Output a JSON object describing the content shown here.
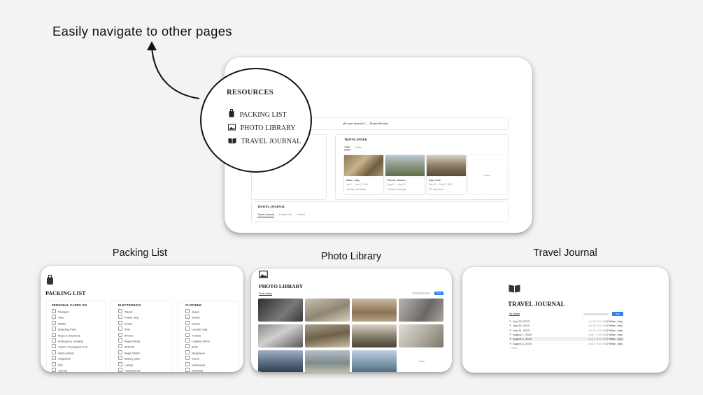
{
  "headline": "Easily navigate to other pages",
  "main_preview": {
    "quote": "ake some memories\" — Donna Sheridan",
    "resources": {
      "title": "RESOURCES",
      "items": [
        {
          "label": "PACKING LIST",
          "icon": "luggage-icon"
        },
        {
          "label": "PHOTO LIBRARY",
          "icon": "image-icon"
        },
        {
          "label": "TRAVEL JOURNAL",
          "icon": "book-icon"
        }
      ]
    },
    "trip_planner": {
      "title": "TRIP PLANNER",
      "tabs": [
        "TRIP",
        "Table"
      ],
      "trips": [
        {
          "place": "Milan, Italy",
          "dates": "Jan 2 → Jan 13, 2024",
          "remaining": "146 days remaining"
        },
        {
          "place": "Rio de Janiero",
          "dates": "Aug 15 → Aug 19",
          "remaining": "25 days remaining"
        },
        {
          "place": "New York",
          "dates": "Feb 18 → Feb 22, 2022",
          "remaining": "517 days since"
        }
      ],
      "new_label": "+ New"
    },
    "travel_journal": {
      "title": "TRAVEL JOURNAL",
      "tabs": [
        "Travel Journal",
        "Bucket List",
        "Visited"
      ]
    }
  },
  "captions": {
    "packing": "Packing List",
    "photo": "Photo Library",
    "journal": "Travel Journal"
  },
  "packing_list": {
    "title": "PACKING LIST",
    "columns": [
      {
        "header": "PERSONAL CARDS ON",
        "items": [
          "Passport",
          "Visa",
          "Wallet",
          "Boarding Pass",
          "Maps & directions",
          "Emergency contacts",
          "Copies of passport & ID",
          "Hotel rentals",
          "Chapstick",
          "Pen",
          "Journal",
          "Pullover",
          "Snacks"
        ]
      },
      {
        "header": "ELECTRONICS",
        "items": [
          "Tripod",
          "Power strip",
          "Kindle",
          "iPad",
          "iPhone",
          "Apple Pencil",
          "AirPods",
          "Apple Watch",
          "Battery pack",
          "Laptop",
          "Headphones",
          "Chargers"
        ]
      },
      {
        "header": "CLOTHING",
        "items": [
          "Jeans",
          "Shorts",
          "Jacket",
          "Laundry bag",
          "T-shirts",
          "Collared shirts",
          "Belts",
          "Sleepwear",
          "Socks",
          "Underwear",
          "Swimsuit",
          "Bras"
        ]
      }
    ]
  },
  "photo_library": {
    "title": "PHOTO LIBRARY",
    "view_tab": "Photo Library",
    "new_button": "New",
    "new_label": "+ New"
  },
  "travel_journal_page": {
    "title": "TRAVEL JOURNAL",
    "view_label": "All entries",
    "new_button": "New",
    "entries": [
      {
        "title": "July 29, 2023",
        "date": "Jul 29 9:00 AM",
        "location": "Milan, Italy"
      },
      {
        "title": "July 30, 2023",
        "date": "Jul 30 9:00 AM",
        "location": "Milan, Italy"
      },
      {
        "title": "July 31, 2023",
        "date": "Jul 31 9:00 AM",
        "location": "Milan, Italy"
      },
      {
        "title": "August 1, 2023",
        "date": "Aug 1 9:00 AM",
        "location": "Milan, Italy"
      },
      {
        "title": "August 2, 2023",
        "date": "Aug 2 9:00 AM",
        "location": "Milan, Italy"
      },
      {
        "title": "August 3, 2023",
        "date": "Aug 3 9:00 AM",
        "location": "Milan, Italy"
      }
    ],
    "new_label": "+ New"
  },
  "colors": {
    "background": "#f3f3f3",
    "accent_blue": "#2f80ed"
  }
}
